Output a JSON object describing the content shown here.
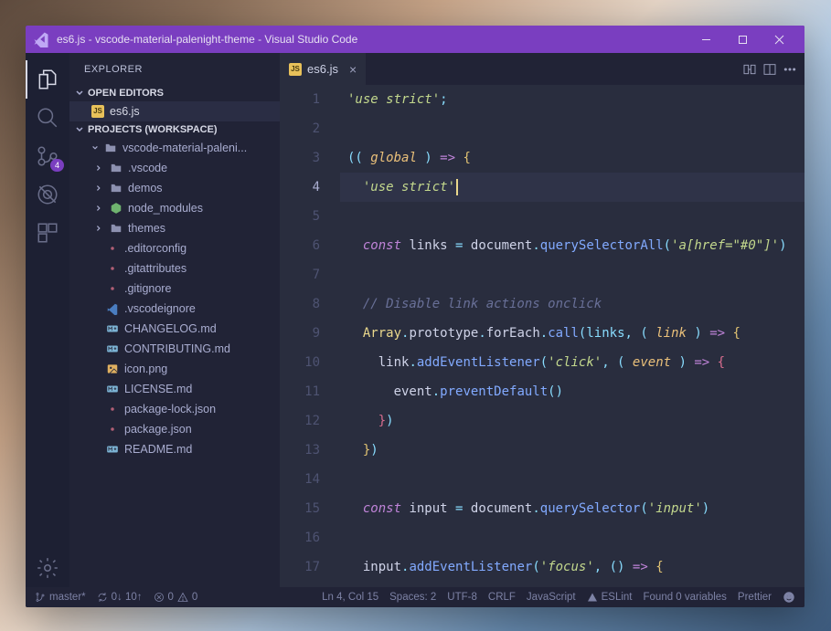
{
  "window": {
    "title": "es6.js - vscode-material-palenight-theme - Visual Studio Code"
  },
  "activity": {
    "badge_scm": "4"
  },
  "sidebar": {
    "title": "EXPLORER",
    "section_open_editors": "OPEN EDITORS",
    "open_editor_file": "es6.js",
    "section_projects": "PROJECTS (WORKSPACE)",
    "root_folder": "vscode-material-paleni...",
    "items": [
      {
        "label": ".vscode",
        "kind": "folder"
      },
      {
        "label": "demos",
        "kind": "folder"
      },
      {
        "label": "node_modules",
        "kind": "node"
      },
      {
        "label": "themes",
        "kind": "folder"
      },
      {
        "label": ".editorconfig",
        "kind": "config"
      },
      {
        "label": ".gitattributes",
        "kind": "config"
      },
      {
        "label": ".gitignore",
        "kind": "config"
      },
      {
        "label": ".vscodeignore",
        "kind": "vs"
      },
      {
        "label": "CHANGELOG.md",
        "kind": "md"
      },
      {
        "label": "CONTRIBUTING.md",
        "kind": "md"
      },
      {
        "label": "icon.png",
        "kind": "img"
      },
      {
        "label": "LICENSE.md",
        "kind": "md"
      },
      {
        "label": "package-lock.json",
        "kind": "config"
      },
      {
        "label": "package.json",
        "kind": "config"
      },
      {
        "label": "README.md",
        "kind": "md"
      }
    ]
  },
  "editor": {
    "tab_name": "es6.js",
    "current_line": 4,
    "lines": [
      {
        "n": 1,
        "tokens": [
          [
            "str",
            "'use strict'"
          ],
          [
            "punc",
            ";"
          ]
        ]
      },
      {
        "n": 2,
        "tokens": []
      },
      {
        "n": 3,
        "tokens": [
          [
            "punc",
            "(( "
          ],
          [
            "par",
            "global"
          ],
          [
            "punc",
            " ) "
          ],
          [
            "key",
            "=>"
          ],
          [
            "punc",
            " "
          ],
          [
            "br",
            "{"
          ]
        ]
      },
      {
        "n": 4,
        "hl": true,
        "tokens": [
          [
            "var",
            "  "
          ],
          [
            "str",
            "'use strict'"
          ],
          [
            "cursor",
            ""
          ]
        ]
      },
      {
        "n": 5,
        "tokens": []
      },
      {
        "n": 6,
        "tokens": [
          [
            "var",
            "  "
          ],
          [
            "key",
            "const"
          ],
          [
            "var",
            " links "
          ],
          [
            "punc",
            "="
          ],
          [
            "var",
            " document"
          ],
          [
            "punc",
            "."
          ],
          [
            "fn",
            "querySelectorAll"
          ],
          [
            "punc",
            "("
          ],
          [
            "str",
            "'a[href=\"#0\"]'"
          ],
          [
            "punc",
            ")"
          ]
        ]
      },
      {
        "n": 7,
        "tokens": []
      },
      {
        "n": 8,
        "tokens": [
          [
            "var",
            "  "
          ],
          [
            "cmt",
            "// Disable link actions onclick"
          ]
        ]
      },
      {
        "n": 9,
        "tokens": [
          [
            "var",
            "  "
          ],
          [
            "obj",
            "Array"
          ],
          [
            "punc",
            "."
          ],
          [
            "var",
            "prototype"
          ],
          [
            "punc",
            "."
          ],
          [
            "var",
            "forEach"
          ],
          [
            "punc",
            "."
          ],
          [
            "fn",
            "call"
          ],
          [
            "punc",
            "(links, ( "
          ],
          [
            "par",
            "link"
          ],
          [
            "punc",
            " ) "
          ],
          [
            "key",
            "=>"
          ],
          [
            "punc",
            " "
          ],
          [
            "br",
            "{"
          ]
        ]
      },
      {
        "n": 10,
        "tokens": [
          [
            "var",
            "    link"
          ],
          [
            "punc",
            "."
          ],
          [
            "fn",
            "addEventListener"
          ],
          [
            "punc",
            "("
          ],
          [
            "str",
            "'click'"
          ],
          [
            "punc",
            ", ( "
          ],
          [
            "par",
            "event"
          ],
          [
            "punc",
            " ) "
          ],
          [
            "key",
            "=>"
          ],
          [
            "punc",
            " "
          ],
          [
            "brc",
            "{"
          ]
        ]
      },
      {
        "n": 11,
        "tokens": [
          [
            "var",
            "      event"
          ],
          [
            "punc",
            "."
          ],
          [
            "fn",
            "preventDefault"
          ],
          [
            "punc",
            "()"
          ]
        ]
      },
      {
        "n": 12,
        "tokens": [
          [
            "var",
            "    "
          ],
          [
            "brc",
            "}"
          ],
          [
            "punc",
            ")"
          ]
        ]
      },
      {
        "n": 13,
        "tokens": [
          [
            "var",
            "  "
          ],
          [
            "br",
            "}"
          ],
          [
            "punc",
            ")"
          ]
        ]
      },
      {
        "n": 14,
        "tokens": []
      },
      {
        "n": 15,
        "tokens": [
          [
            "var",
            "  "
          ],
          [
            "key",
            "const"
          ],
          [
            "var",
            " input "
          ],
          [
            "punc",
            "="
          ],
          [
            "var",
            " document"
          ],
          [
            "punc",
            "."
          ],
          [
            "fn",
            "querySelector"
          ],
          [
            "punc",
            "("
          ],
          [
            "str",
            "'input'"
          ],
          [
            "punc",
            ")"
          ]
        ]
      },
      {
        "n": 16,
        "tokens": []
      },
      {
        "n": 17,
        "tokens": [
          [
            "var",
            "  input"
          ],
          [
            "punc",
            "."
          ],
          [
            "fn",
            "addEventListener"
          ],
          [
            "punc",
            "("
          ],
          [
            "str",
            "'focus'"
          ],
          [
            "punc",
            ", () "
          ],
          [
            "key",
            "=>"
          ],
          [
            "punc",
            " "
          ],
          [
            "br",
            "{"
          ]
        ]
      }
    ]
  },
  "status": {
    "branch": "master*",
    "sync": "0↓ 10↑",
    "errors": "0",
    "warnings": "0",
    "cursor": "Ln 4, Col 15",
    "spaces": "Spaces: 2",
    "encoding": "UTF-8",
    "eol": "CRLF",
    "lang": "JavaScript",
    "eslint": "ESLint",
    "found": "Found 0 variables",
    "prettier": "Prettier"
  }
}
